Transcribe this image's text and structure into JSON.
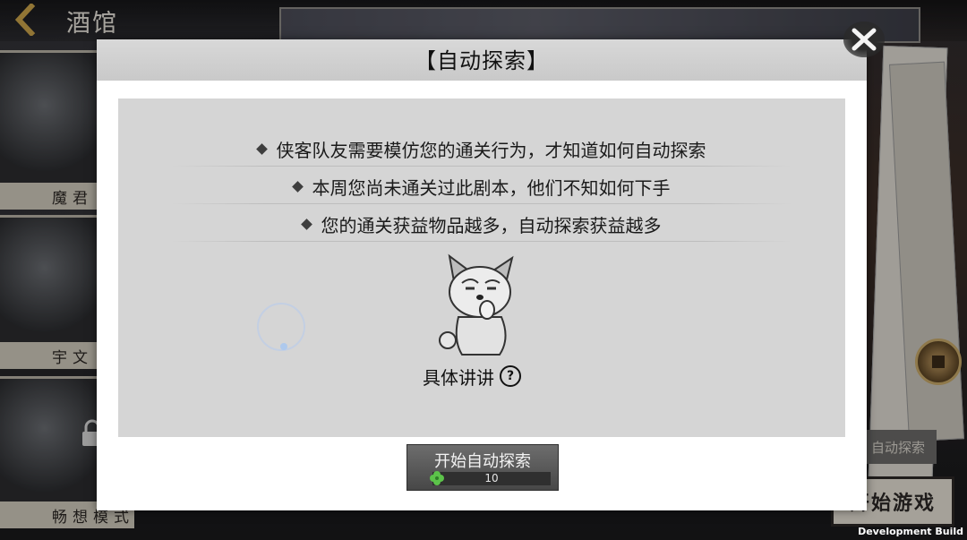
{
  "header": {
    "title": "酒馆"
  },
  "side_cards": [
    {
      "label": "魔君"
    },
    {
      "label": "宇文"
    },
    {
      "label": "畅想模式"
    }
  ],
  "background_buttons": {
    "auto_explore": "自动探索",
    "start_game": "开始游戏"
  },
  "dialog": {
    "title": "【自动探索】",
    "tips": [
      "侠客队友需要模仿您的通关行为，才知道如何自动探索",
      "本周您尚未通关过此剧本，他们不知如何下手",
      "您的通关获益物品越多，自动探索获益越多"
    ],
    "details_label": "具体讲讲",
    "help_icon_glyph": "?",
    "start_button": {
      "label": "开始自动探索",
      "cost": "10"
    }
  },
  "footer": {
    "build_label": "Development Build"
  },
  "colors": {
    "panel_bg": "#d5d5d5",
    "button_bg": "#5a5a5a",
    "clover": "#5cc34a"
  }
}
